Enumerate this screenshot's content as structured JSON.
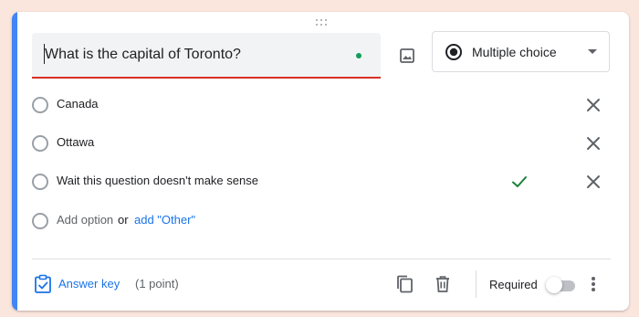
{
  "question": {
    "title": "What is the capital of Toronto?",
    "type_label": "Multiple choice"
  },
  "options": [
    {
      "label": "Canada",
      "correct": false
    },
    {
      "label": "Ottawa",
      "correct": false
    },
    {
      "label": "Wait this question doesn't make sense",
      "correct": true
    }
  ],
  "add_option": {
    "placeholder": "Add option",
    "or_text": "or",
    "other_link": "add \"Other\""
  },
  "footer": {
    "answer_key_label": "Answer key",
    "points_label": "(1 point)",
    "required_label": "Required",
    "required_on": false
  },
  "colors": {
    "accent": "#4285f4",
    "link": "#1a73e8",
    "underline_error": "#d93025",
    "correct_check": "#188038",
    "status_dot": "#0f9d58",
    "page_background": "#fbe6dd"
  },
  "icons": {
    "drag": "drag-handle-icon",
    "image": "image-icon",
    "type": "radio-button-icon",
    "remove": "close-icon",
    "correct": "check-icon",
    "answer_key": "clipboard-check-icon",
    "duplicate": "copy-icon",
    "delete": "trash-icon",
    "more": "more-vert-icon"
  }
}
